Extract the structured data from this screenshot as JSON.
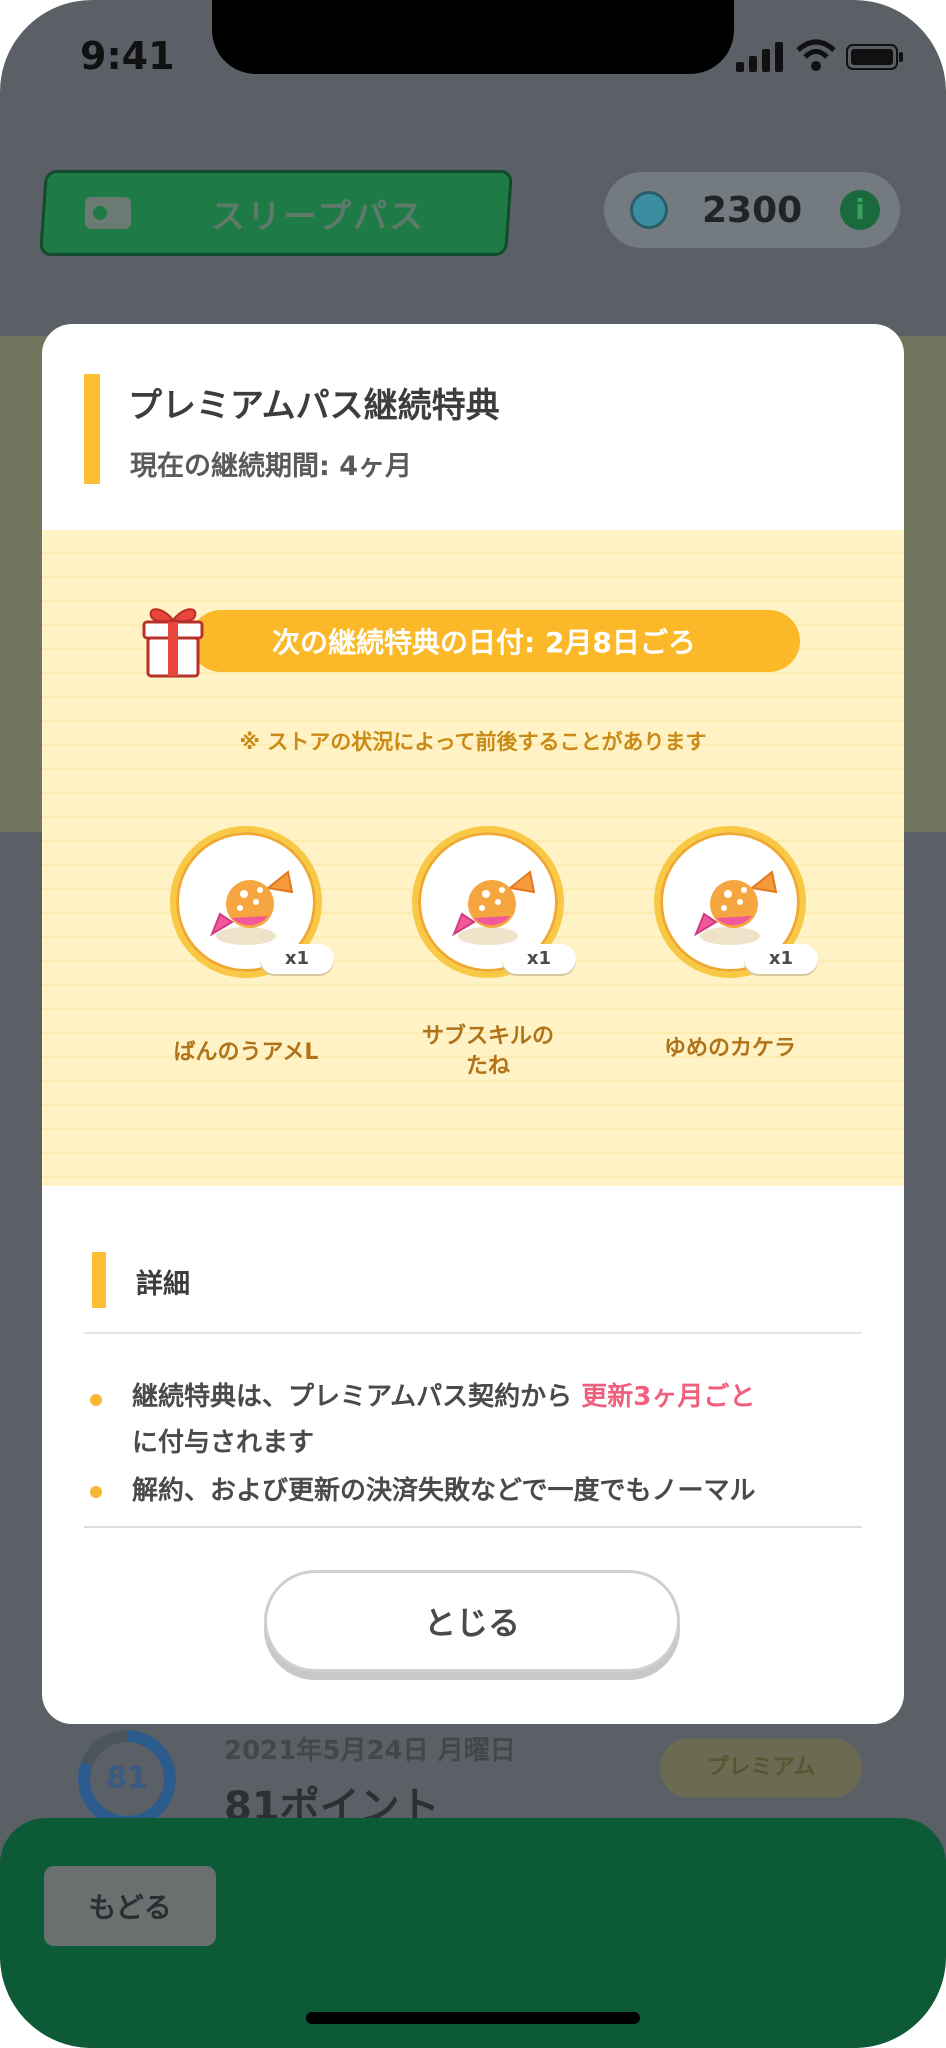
{
  "status_bar": {
    "time": "9:41"
  },
  "header": {
    "pass_label": "スリープパス",
    "gem_count": "2300"
  },
  "history": {
    "score": "81",
    "date": "2021年5月24日 月曜日",
    "points": "81ポイント",
    "badge": "プレミアム"
  },
  "footer": {
    "back_label": "もどる"
  },
  "modal": {
    "title": "プレミアムパス継続特典",
    "subtitle": "現在の継続期間: 4ヶ月",
    "next_date": "次の継続特典の日付: 2月8日ごろ",
    "notice": "※ ストアの状況によって前後することがあります",
    "rewards": [
      {
        "name": "ばんのうアメL",
        "qty": "x1"
      },
      {
        "name_line1": "サブスキルの",
        "name_line2": "たね",
        "qty": "x1"
      },
      {
        "name": "ゆめのカケラ",
        "qty": "x1"
      }
    ],
    "details_title": "詳細",
    "detail_1_part1": "継続特典は、プレミアムパス契約から",
    "detail_1_highlight": "更新3ヶ月ごと",
    "detail_1_part2": "に付与されます",
    "detail_2": "解約、および更新の決済失敗などで一度でもノーマル",
    "close_label": "とじる"
  },
  "colors": {
    "accent_yellow": "#fbbf35",
    "highlight_pink": "#f0607e",
    "footer_green": "#0d5a36"
  }
}
